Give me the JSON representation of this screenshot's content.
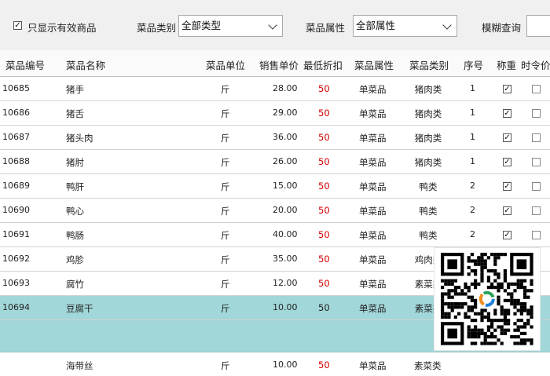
{
  "toolbar": {
    "only_valid_label": "只显示有效商品",
    "only_valid_checked": true,
    "category_label": "菜品类别",
    "category_value": "全部类型",
    "attribute_label": "菜品属性",
    "attribute_value": "全部属性",
    "search_label": "模糊查询",
    "search_value": ""
  },
  "table": {
    "headers": [
      "菜品编号",
      "菜品名称",
      "菜品单位",
      "销售单价",
      "最低折扣",
      "菜品属性",
      "菜品类别",
      "序号",
      "称重",
      "时令价"
    ],
    "rows": [
      {
        "code": "10685",
        "name": "猪手",
        "unit": "斤",
        "price": "28.00",
        "discount": "50",
        "attr": "单菜品",
        "category": "猪肉类",
        "seq": "1",
        "weigh": true,
        "seasonal": false
      },
      {
        "code": "10686",
        "name": "猪舌",
        "unit": "斤",
        "price": "29.00",
        "discount": "50",
        "attr": "单菜品",
        "category": "猪肉类",
        "seq": "1",
        "weigh": true,
        "seasonal": false
      },
      {
        "code": "10687",
        "name": "猪头肉",
        "unit": "斤",
        "price": "36.00",
        "discount": "50",
        "attr": "单菜品",
        "category": "猪肉类",
        "seq": "1",
        "weigh": true,
        "seasonal": false
      },
      {
        "code": "10688",
        "name": "猪肘",
        "unit": "斤",
        "price": "26.00",
        "discount": "50",
        "attr": "单菜品",
        "category": "猪肉类",
        "seq": "1",
        "weigh": true,
        "seasonal": false
      },
      {
        "code": "10689",
        "name": "鸭肝",
        "unit": "斤",
        "price": "15.00",
        "discount": "50",
        "attr": "单菜品",
        "category": "鸭类",
        "seq": "2",
        "weigh": true,
        "seasonal": false
      },
      {
        "code": "10690",
        "name": "鸭心",
        "unit": "斤",
        "price": "20.00",
        "discount": "50",
        "attr": "单菜品",
        "category": "鸭类",
        "seq": "2",
        "weigh": true,
        "seasonal": false
      },
      {
        "code": "10691",
        "name": "鸭肠",
        "unit": "斤",
        "price": "40.00",
        "discount": "50",
        "attr": "单菜品",
        "category": "鸭类",
        "seq": "2",
        "weigh": true,
        "seasonal": false
      },
      {
        "code": "10692",
        "name": "鸡胗",
        "unit": "斤",
        "price": "35.00",
        "discount": "50",
        "attr": "单菜品",
        "category": "鸡肉类",
        "seq": "",
        "weigh": false,
        "seasonal": false
      },
      {
        "code": "10693",
        "name": "腐竹",
        "unit": "斤",
        "price": "12.00",
        "discount": "50",
        "attr": "单菜品",
        "category": "素菜类",
        "seq": "",
        "weigh": false,
        "seasonal": false
      },
      {
        "code": "10694",
        "name": "豆腐干",
        "unit": "斤",
        "price": "10.00",
        "discount": "50",
        "attr": "单菜品",
        "category": "素菜类",
        "seq": "",
        "weigh": false,
        "seasonal": false,
        "selected": true
      }
    ],
    "partial_row": {
      "name": "海带丝",
      "unit": "斤",
      "price": "10.00",
      "discount": "50",
      "attr": "单菜品",
      "category": "素菜类"
    }
  },
  "colors": {
    "selected_row": "#a2d7d9",
    "discount_text": "#d40000",
    "toolbar_bg": "#f0f0f0"
  },
  "icons": [
    "checkbox-icon",
    "chevron-down-icon",
    "qr-code-icon"
  ]
}
